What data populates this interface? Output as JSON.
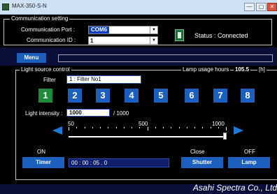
{
  "window": {
    "title": "MAX-350-S-N",
    "min_glyph": "—",
    "max_glyph": "▢",
    "close_glyph": "✕"
  },
  "communication": {
    "legend": "Communication setting",
    "port_label": "Communication Port :",
    "port_value": "COM6",
    "id_label": "Communication ID :",
    "id_value": "1",
    "status": "Status : Connected"
  },
  "menu": {
    "label": "Menu"
  },
  "light_source": {
    "legend": "Light source control",
    "lamp_hours_label": "Lamp usage hours",
    "lamp_hours_value": "105.5",
    "lamp_hours_unit": "[h]",
    "filter_label": "Filter",
    "filter_value": "1 : Filter No1",
    "filter_buttons": [
      "1",
      "2",
      "3",
      "4",
      "5",
      "6",
      "7",
      "8"
    ],
    "active_filter": "1",
    "intensity_label": "Light intensity :",
    "intensity_value": "1000",
    "intensity_max": "/ 1000",
    "slider_ticks": [
      "50",
      "500",
      "1000"
    ],
    "slider_level_fraction": 1.0
  },
  "controls": {
    "timer_state": "ON",
    "timer_button": "Timer",
    "timer_value": "00 : 00 : 05 . 0",
    "shutter_state": "Close",
    "shutter_button": "Shutter",
    "lamp_state": "OFF",
    "lamp_button": "Lamp"
  },
  "footer": {
    "brand": "Asahi Spectra Co., Ltd"
  },
  "colors": {
    "button_blue": "#1b5fbf",
    "active_green": "#1d8a3c",
    "background": "#0a0f3a"
  }
}
